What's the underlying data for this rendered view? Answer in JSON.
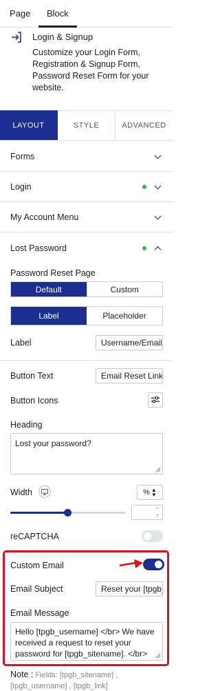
{
  "top_tabs": {
    "page": "Page",
    "block": "Block"
  },
  "block": {
    "icon": "login-arrow-icon",
    "title": "Login & Signup",
    "description": "Customize your Login Form, Registration & Signup Form, Password Reset Form for your website."
  },
  "panel_tabs": {
    "layout": "LAYOUT",
    "style": "STYLE",
    "advanced": "ADVANCED"
  },
  "sections": {
    "forms": "Forms",
    "login": "Login",
    "my_account_menu": "My Account Menu",
    "lost_password": "Lost Password"
  },
  "lost_password": {
    "reset_page_label": "Password Reset Page",
    "reset_page_options": [
      "Default",
      "Custom"
    ],
    "label_mode_options": [
      "Label",
      "Placeholder"
    ],
    "label_label": "Label",
    "label_value": "Username/Email",
    "button_text_label": "Button Text",
    "button_text_value": "Email Reset Link",
    "button_icons_label": "Button Icons",
    "heading_label": "Heading",
    "heading_value": "Lost your password?",
    "width_label": "Width",
    "width_unit": "%",
    "width_slider_fraction": 0.5,
    "recaptcha_label": "reCAPTCHA",
    "recaptcha_on": false,
    "custom_email_label": "Custom Email",
    "custom_email_on": true,
    "email_subject_label": "Email Subject",
    "email_subject_value": "Reset your [tpgb_sitename] password",
    "email_message_label": "Email Message",
    "email_message_value": "Hello [tpgb_username] </br> We have received a request to reset your password for [tpgb_sitename]. </br> Please use the following link",
    "note_label": "Note :",
    "note_text": "Fields: [tpgb_sitename] , [tpgb_username] , [tpgb_link]"
  },
  "colors": {
    "accent": "#1a2f8f",
    "status_dot": "#22c33a",
    "highlight": "#e0101e"
  }
}
